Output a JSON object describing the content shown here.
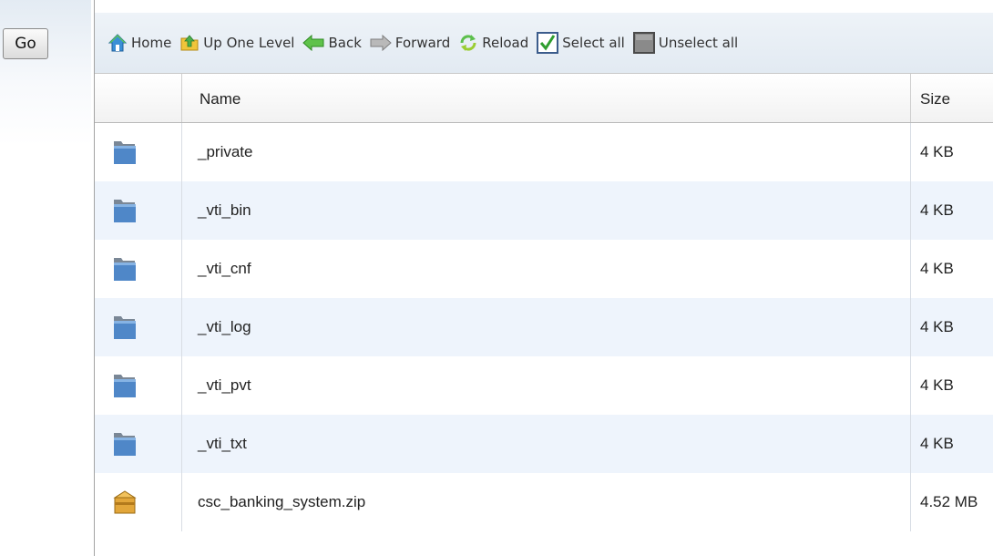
{
  "search": {
    "go_label": "Go"
  },
  "toolbar": {
    "home": "Home",
    "up_one_level": "Up One Level",
    "back": "Back",
    "forward": "Forward",
    "reload": "Reload",
    "select_all": "Select all",
    "unselect_all": "Unselect all"
  },
  "table": {
    "columns": {
      "name": "Name",
      "size": "Size"
    },
    "rows": [
      {
        "name": "_private",
        "size": "4 KB",
        "icon": "folder-icon"
      },
      {
        "name": "_vti_bin",
        "size": "4 KB",
        "icon": "folder-icon"
      },
      {
        "name": "_vti_cnf",
        "size": "4 KB",
        "icon": "folder-icon"
      },
      {
        "name": "_vti_log",
        "size": "4 KB",
        "icon": "folder-icon"
      },
      {
        "name": "_vti_pvt",
        "size": "4 KB",
        "icon": "folder-icon"
      },
      {
        "name": "_vti_txt",
        "size": "4 KB",
        "icon": "folder-icon"
      },
      {
        "name": "csc_banking_system.zip",
        "size": "4.52 MB",
        "icon": "archive-icon"
      }
    ]
  },
  "colors": {
    "row_alt": "#eef4fc",
    "folder": "#4f87c8",
    "archive": "#e2a63a",
    "toolbar_bg": "#e8eef5"
  }
}
